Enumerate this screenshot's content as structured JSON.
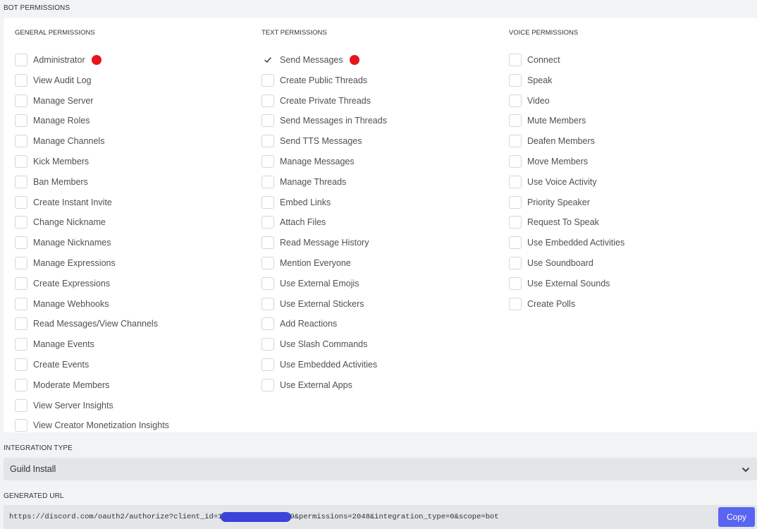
{
  "bot_permissions": {
    "title": "BOT PERMISSIONS",
    "columns": [
      {
        "title": "GENERAL PERMISSIONS",
        "items": [
          {
            "label": "Administrator",
            "checked": false,
            "marked": true
          },
          {
            "label": "View Audit Log",
            "checked": false
          },
          {
            "label": "Manage Server",
            "checked": false
          },
          {
            "label": "Manage Roles",
            "checked": false
          },
          {
            "label": "Manage Channels",
            "checked": false
          },
          {
            "label": "Kick Members",
            "checked": false
          },
          {
            "label": "Ban Members",
            "checked": false
          },
          {
            "label": "Create Instant Invite",
            "checked": false
          },
          {
            "label": "Change Nickname",
            "checked": false
          },
          {
            "label": "Manage Nicknames",
            "checked": false
          },
          {
            "label": "Manage Expressions",
            "checked": false
          },
          {
            "label": "Create Expressions",
            "checked": false
          },
          {
            "label": "Manage Webhooks",
            "checked": false
          },
          {
            "label": "Read Messages/View Channels",
            "checked": false
          },
          {
            "label": "Manage Events",
            "checked": false
          },
          {
            "label": "Create Events",
            "checked": false
          },
          {
            "label": "Moderate Members",
            "checked": false
          },
          {
            "label": "View Server Insights",
            "checked": false
          },
          {
            "label": "View Creator Monetization Insights",
            "checked": false
          }
        ]
      },
      {
        "title": "TEXT PERMISSIONS",
        "items": [
          {
            "label": "Send Messages",
            "checked": true,
            "marked": true
          },
          {
            "label": "Create Public Threads",
            "checked": false
          },
          {
            "label": "Create Private Threads",
            "checked": false
          },
          {
            "label": "Send Messages in Threads",
            "checked": false
          },
          {
            "label": "Send TTS Messages",
            "checked": false
          },
          {
            "label": "Manage Messages",
            "checked": false
          },
          {
            "label": "Manage Threads",
            "checked": false
          },
          {
            "label": "Embed Links",
            "checked": false
          },
          {
            "label": "Attach Files",
            "checked": false
          },
          {
            "label": "Read Message History",
            "checked": false
          },
          {
            "label": "Mention Everyone",
            "checked": false
          },
          {
            "label": "Use External Emojis",
            "checked": false
          },
          {
            "label": "Use External Stickers",
            "checked": false
          },
          {
            "label": "Add Reactions",
            "checked": false
          },
          {
            "label": "Use Slash Commands",
            "checked": false
          },
          {
            "label": "Use Embedded Activities",
            "checked": false
          },
          {
            "label": "Use External Apps",
            "checked": false
          }
        ]
      },
      {
        "title": "VOICE PERMISSIONS",
        "items": [
          {
            "label": "Connect",
            "checked": false
          },
          {
            "label": "Speak",
            "checked": false
          },
          {
            "label": "Video",
            "checked": false
          },
          {
            "label": "Mute Members",
            "checked": false
          },
          {
            "label": "Deafen Members",
            "checked": false
          },
          {
            "label": "Move Members",
            "checked": false
          },
          {
            "label": "Use Voice Activity",
            "checked": false
          },
          {
            "label": "Priority Speaker",
            "checked": false
          },
          {
            "label": "Request To Speak",
            "checked": false
          },
          {
            "label": "Use Embedded Activities",
            "checked": false
          },
          {
            "label": "Use Soundboard",
            "checked": false
          },
          {
            "label": "Use External Sounds",
            "checked": false
          },
          {
            "label": "Create Polls",
            "checked": false
          }
        ]
      }
    ]
  },
  "integration_type": {
    "title": "INTEGRATION TYPE",
    "selected": "Guild Install",
    "icon": "chevron-down-icon"
  },
  "generated_url": {
    "title": "GENERATED URL",
    "url_prefix": "https://discord.com/oauth2/authorize?client_id=1",
    "url_suffix": "9&permissions=2048&integration_type=0&scope=bot",
    "copy_label": "Copy"
  },
  "colors": {
    "accent": "#5865f2",
    "marker": "#e8141c",
    "redaction": "#3b44d8"
  }
}
